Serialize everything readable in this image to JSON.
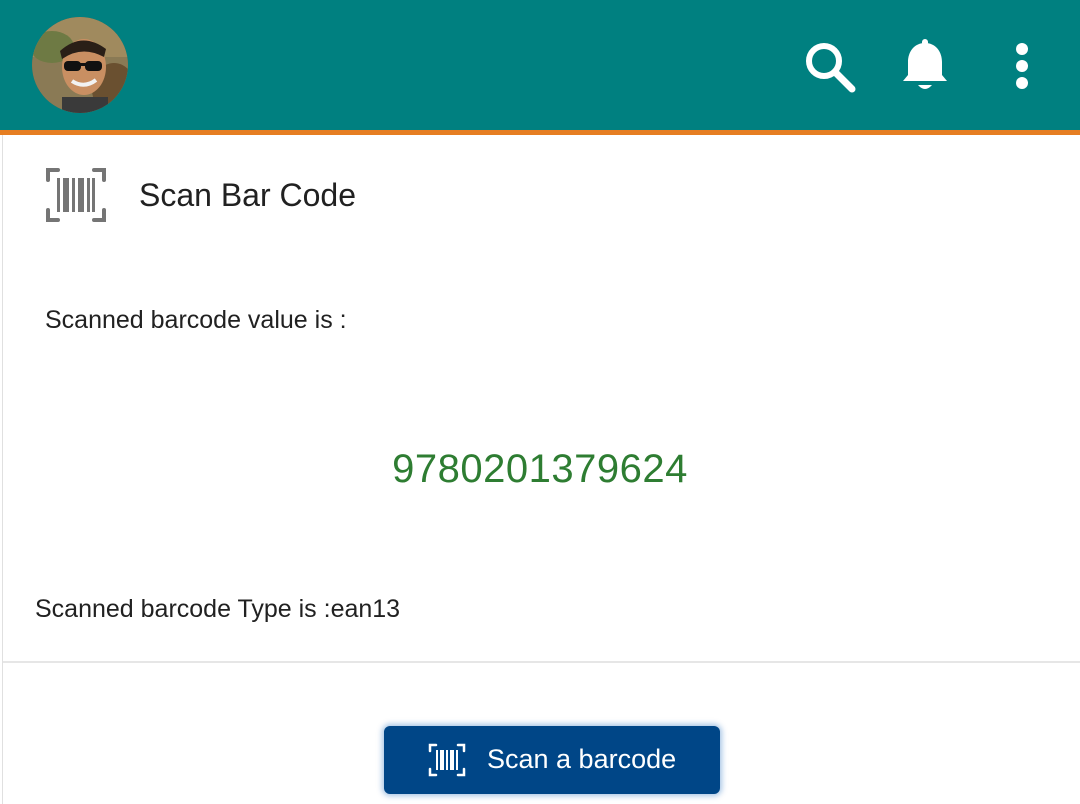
{
  "app_bar": {
    "background": "#008080",
    "accent_color": "#e67e22",
    "avatar_icon": "user-avatar",
    "actions": [
      {
        "name": "search-icon"
      },
      {
        "name": "bell-icon"
      },
      {
        "name": "more-vertical-icon"
      }
    ]
  },
  "card": {
    "header_icon": "barcode-scanner-icon",
    "title": "Scan Bar Code",
    "value_label": "Scanned barcode value is :",
    "barcode_value": "9780201379624",
    "barcode_value_color": "#2e7d32",
    "type_label": "Scanned barcode Type is :ean13"
  },
  "scan_button": {
    "icon": "barcode-scanner-icon",
    "label": "Scan a barcode",
    "background": "#004687"
  }
}
